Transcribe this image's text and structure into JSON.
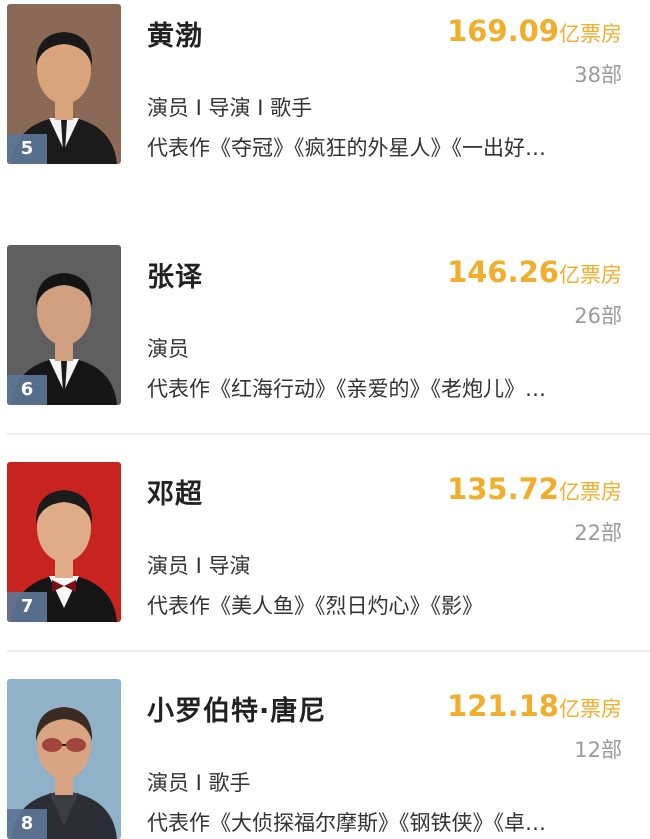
{
  "actors": [
    {
      "rank": "5",
      "name": "黄渤",
      "box_office": "169.09",
      "unit": "亿票房",
      "films": "38部",
      "roles": "演员 I 导演 I 歌手",
      "works": "代表作《夺冠》《疯狂的外星人》《一出好…",
      "photo": {
        "bg": "#8a6a56",
        "suit": "#1b1b1b",
        "shirt": "#f3f3f3",
        "skin": "#d9a47c",
        "hair": "#191919",
        "extra": "none"
      }
    },
    {
      "rank": "6",
      "name": "张译",
      "box_office": "146.26",
      "unit": "亿票房",
      "films": "26部",
      "roles": "演员",
      "works": "代表作《红海行动》《亲爱的》《老炮儿》…",
      "photo": {
        "bg": "#5e5e5e",
        "suit": "#161616",
        "shirt": "#f4f4f4",
        "skin": "#cf9f80",
        "hair": "#141414",
        "extra": "none"
      }
    },
    {
      "rank": "7",
      "name": "邓超",
      "box_office": "135.72",
      "unit": "亿票房",
      "films": "22部",
      "roles": "演员 I 导演",
      "works": "代表作《美人鱼》《烈日灼心》《影》",
      "photo": {
        "bg": "#c8231f",
        "suit": "#161616",
        "shirt": "#f6f6f6",
        "skin": "#e0ad88",
        "hair": "#1c1c1c",
        "extra": "bowtie"
      }
    },
    {
      "rank": "8",
      "name": "小罗伯特·唐尼",
      "box_office": "121.18",
      "unit": "亿票房",
      "films": "12部",
      "roles": "演员 I 歌手",
      "works": "代表作《大侦探福尔摩斯》《钢铁侠》《卓…",
      "photo": {
        "bg": "#8fb2c8",
        "suit": "#2a2d33",
        "shirt": "#3a3d44",
        "skin": "#d8a481",
        "hair": "#3b2a20",
        "extra": "glasses"
      }
    }
  ]
}
